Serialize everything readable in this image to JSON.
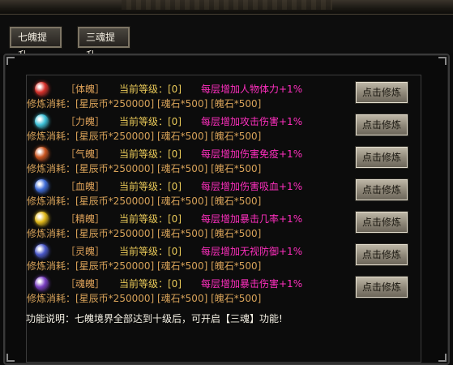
{
  "tabs": [
    {
      "label": "七魄提升"
    },
    {
      "label": "三魂提升"
    }
  ],
  "rows": [
    {
      "name": "［体魄］",
      "level_label": "当前等级：[0]",
      "bonus": "每层增加人物体力+1%",
      "cost": "修炼消耗：[星辰币*250000] [魂石*500] [魄石*500]",
      "button": "点击修炼",
      "color": "#d6302a"
    },
    {
      "name": "［力魄］",
      "level_label": "当前等级：[0]",
      "bonus": "每层增加攻击伤害+1%",
      "cost": "修炼消耗：[星辰币*250000] [魂石*500] [魄石*500]",
      "button": "点击修炼",
      "color": "#3ec1d8"
    },
    {
      "name": "［气魄］",
      "level_label": "当前等级：[0]",
      "bonus": "每层增加伤害免疫+1%",
      "cost": "修炼消耗：[星辰币*250000] [魂石*500] [魄石*500]",
      "button": "点击修炼",
      "color": "#c9541f"
    },
    {
      "name": "［血魄］",
      "level_label": "当前等级：[0]",
      "bonus": "每层增加伤害吸血+1%",
      "cost": "修炼消耗：[星辰币*250000] [魂石*500] [魄石*500]",
      "button": "点击修炼",
      "color": "#3f6cd6"
    },
    {
      "name": "［精魄］",
      "level_label": "当前等级：[0]",
      "bonus": "每层增加暴击几率+1%",
      "cost": "修炼消耗：[星辰币*250000] [魂石*500] [魄石*500]",
      "button": "点击修炼",
      "color": "#e0b819"
    },
    {
      "name": "［灵魄］",
      "level_label": "当前等级：[0]",
      "bonus": "每层增加无视防御+1%",
      "cost": "修炼消耗：[星辰币*250000] [魂石*500] [魄石*500]",
      "button": "点击修炼",
      "color": "#4a58c8"
    },
    {
      "name": "［魂魄］",
      "level_label": "当前等级：[0]",
      "bonus": "每层增加暴击伤害+1%",
      "cost": "修炼消耗：[星辰币*250000] [魂石*500] [魄石*500]",
      "button": "点击修炼",
      "color": "#7a3fc2"
    }
  ],
  "note": "功能说明：七魄境界全部达到十级后，可开启【三魂】功能!"
}
